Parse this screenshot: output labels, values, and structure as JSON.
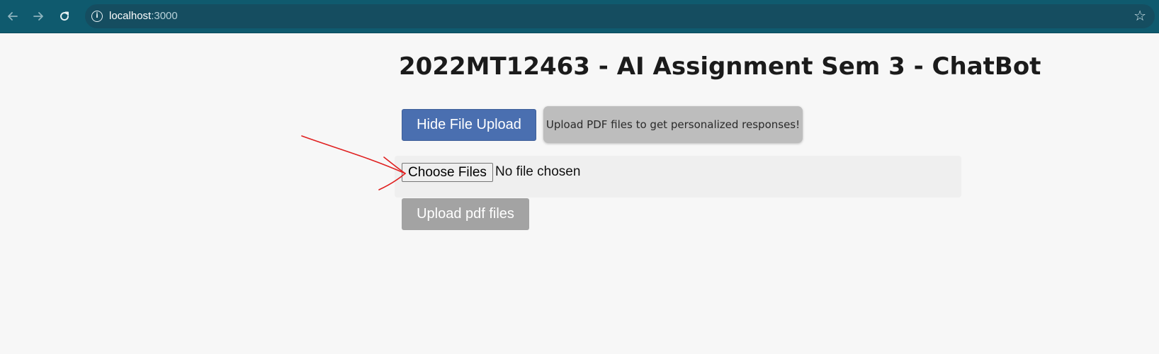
{
  "browser": {
    "url_host": "localhost",
    "url_port": ":3000",
    "icons": {
      "back": "arrow-left-icon",
      "forward": "arrow-right-icon",
      "reload": "reload-icon",
      "site_info": "info-icon",
      "bookmark": "star-icon"
    },
    "theme_color": "#0f5a6e"
  },
  "page": {
    "title": "2022MT12463 - AI Assignment Sem 3 - ChatBot",
    "hide_upload_label": "Hide File Upload",
    "tip_text": "Upload PDF files to get personalized responses!",
    "choose_files_label": "Choose Files",
    "file_status": "No file chosen",
    "upload_pdf_label": "Upload pdf files"
  },
  "annotation": {
    "type": "red-hand-drawn-arrow",
    "color": "#e02020",
    "points_to": "choose-files-button"
  }
}
